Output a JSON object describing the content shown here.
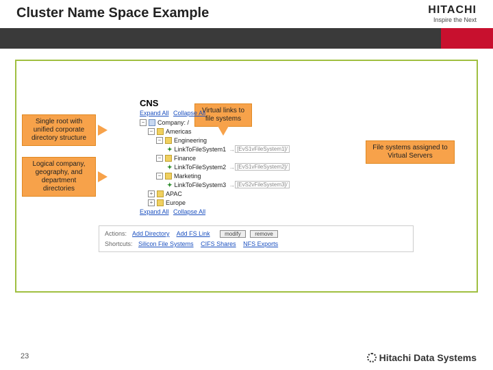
{
  "title": "Cluster Name Space Example",
  "brand": {
    "name": "HITACHI",
    "tagline": "Inspire the Next"
  },
  "callouts": {
    "root": "Single root with unified corporate directory structure",
    "logical": "Logical company, geography, and department directories",
    "vlinks": "Virtual links to file systems",
    "assigned": "File systems assigned to Virtual Servers"
  },
  "cns": {
    "heading": "CNS",
    "expand": "Expand All",
    "collapse": "Collapse All",
    "tree": {
      "root": "Company: /",
      "americas": "Americas",
      "engineering": "Engineering",
      "link1": "LinkToFileSystem1",
      "target1": "[EvS1vFileSystem1]/",
      "finance": "Finance",
      "link2": "LinkToFileSystem2",
      "target2": "[EvS1vFileSystem2]/",
      "marketing": "Marketing",
      "link3": "LinkToFileSystem3",
      "target3": "[EvS2vFileSystem3]/",
      "apac": "APAC",
      "europe": "Europe"
    }
  },
  "actions": {
    "label": "Actions:",
    "add_dir": "Add Directory",
    "add_fs": "Add FS Link",
    "modify": "modify",
    "remove": "remove",
    "shortcuts_label": "Shortcuts:",
    "sfs": "Silicon File Systems",
    "cifs": "CIFS Shares",
    "nfs": "NFS Exports"
  },
  "footer": {
    "page": "23",
    "brand": "Hitachi Data Systems"
  }
}
